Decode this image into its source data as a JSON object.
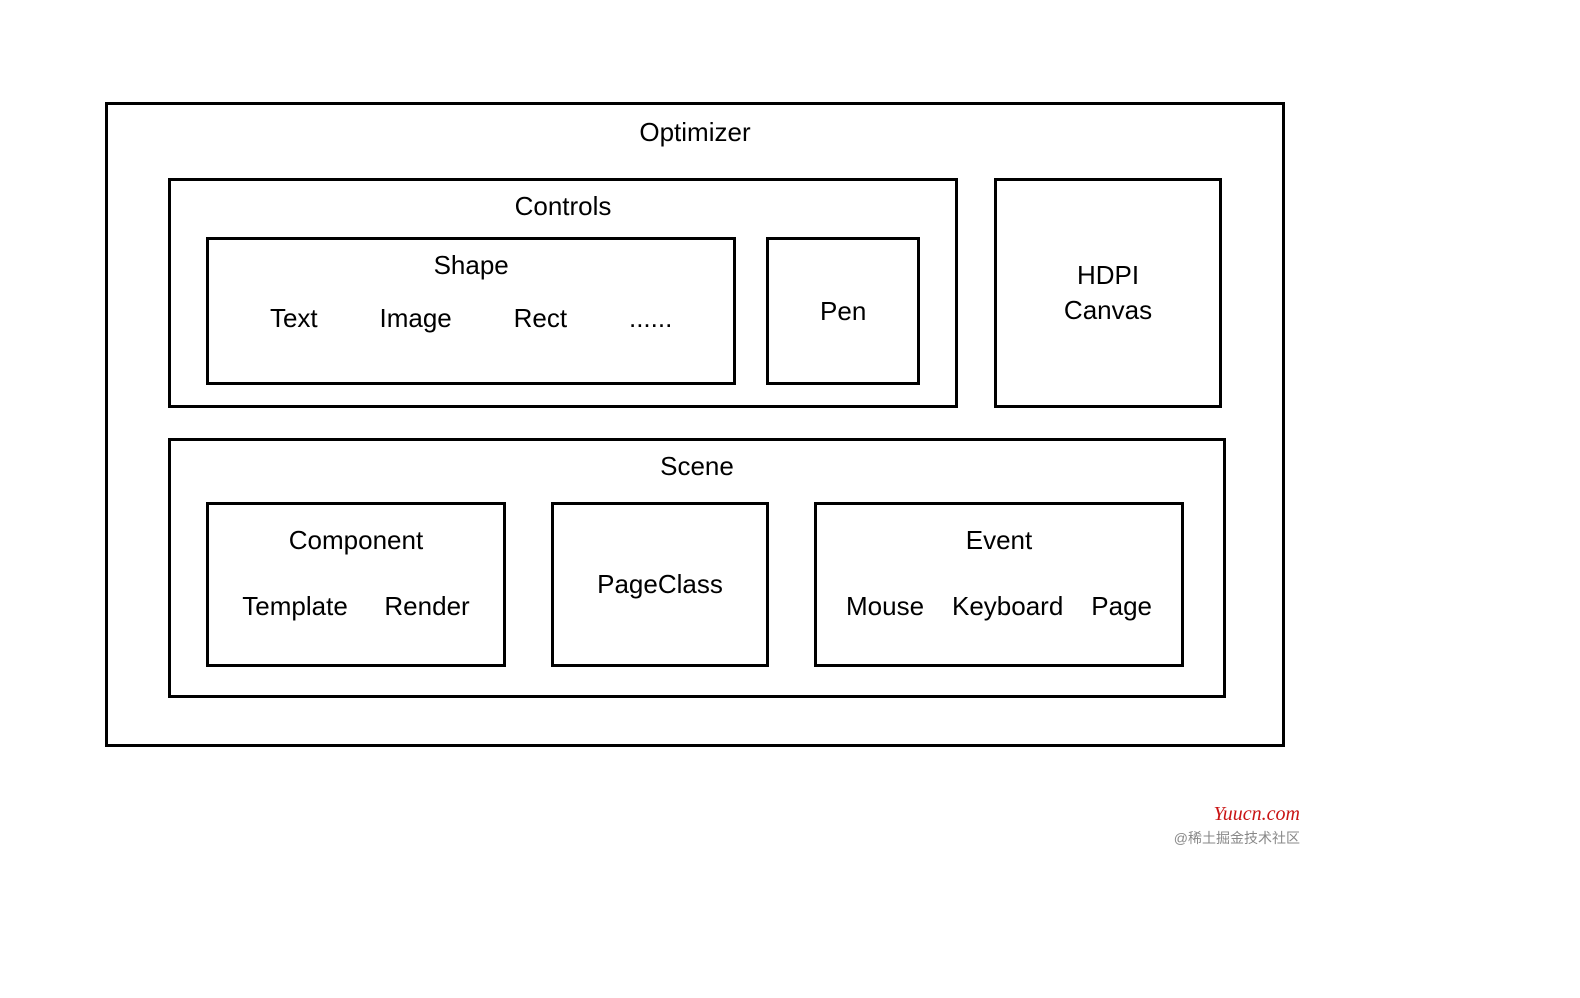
{
  "optimizer": {
    "title": "Optimizer",
    "controls": {
      "title": "Controls",
      "shape": {
        "title": "Shape",
        "items": [
          "Text",
          "Image",
          "Rect",
          "......"
        ]
      },
      "pen": "Pen"
    },
    "hdpi": {
      "line1": "HDPI",
      "line2": "Canvas"
    },
    "scene": {
      "title": "Scene",
      "component": {
        "title": "Component",
        "items": [
          "Template",
          "Render"
        ]
      },
      "pageclass": "PageClass",
      "event": {
        "title": "Event",
        "items": [
          "Mouse",
          "Keyboard",
          "Page"
        ]
      }
    }
  },
  "watermark": {
    "main": "Yuucn.com",
    "sub": "@稀土掘金技术社区"
  }
}
